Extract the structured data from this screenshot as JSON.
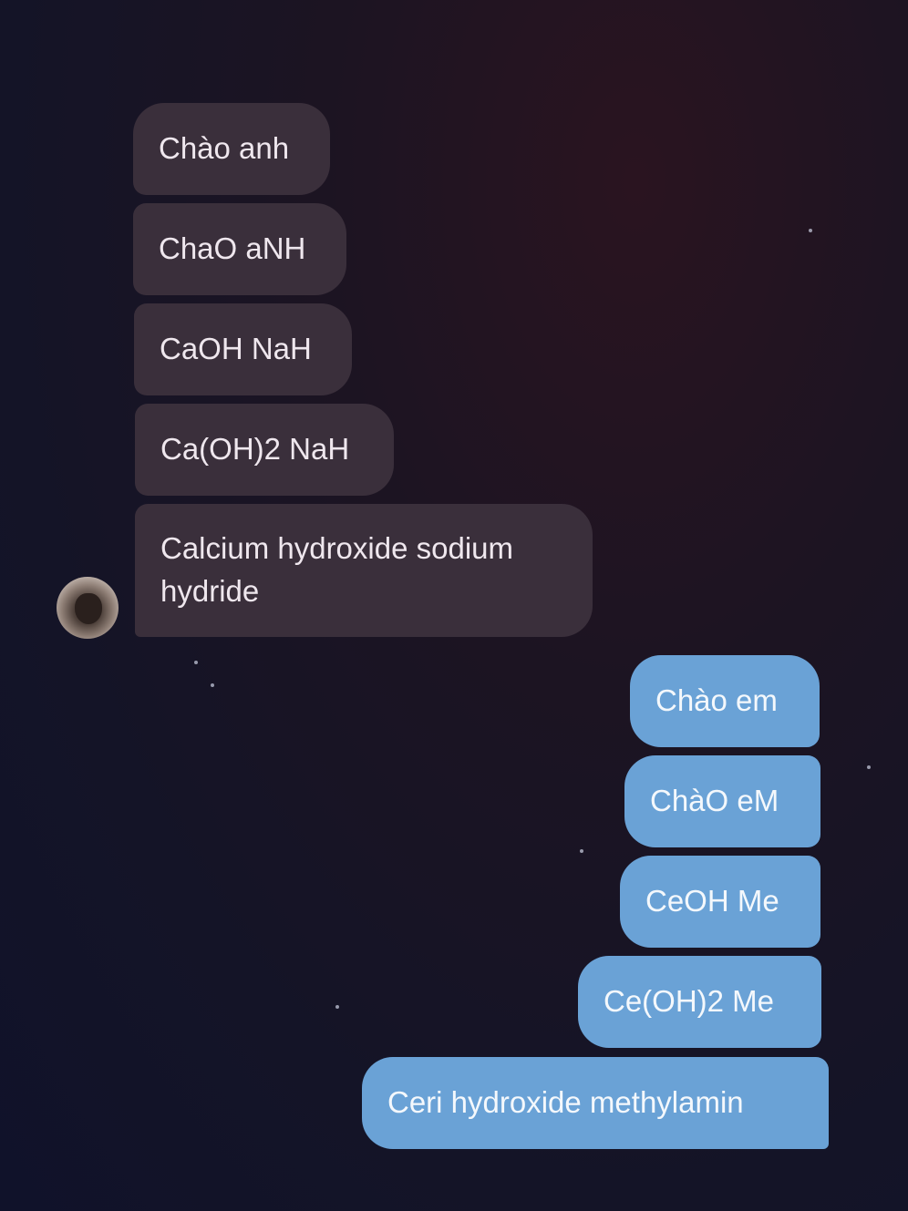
{
  "received": [
    {
      "text": "Chào anh"
    },
    {
      "text": "ChaO aNH"
    },
    {
      "text": "CaOH NaH"
    },
    {
      "text": "Ca(OH)2 NaH"
    },
    {
      "text": "Calcium hydroxide sodium hydride"
    }
  ],
  "sent": [
    {
      "text": "Chào em"
    },
    {
      "text": "ChàO eM"
    },
    {
      "text": "CeOH Me"
    },
    {
      "text": "Ce(OH)2 Me"
    },
    {
      "text": "Ceri hydroxide methylamin"
    }
  ],
  "colors": {
    "received_bubble": "#3a2f3b",
    "sent_bubble": "#6aa2d6",
    "background": "#151528"
  }
}
